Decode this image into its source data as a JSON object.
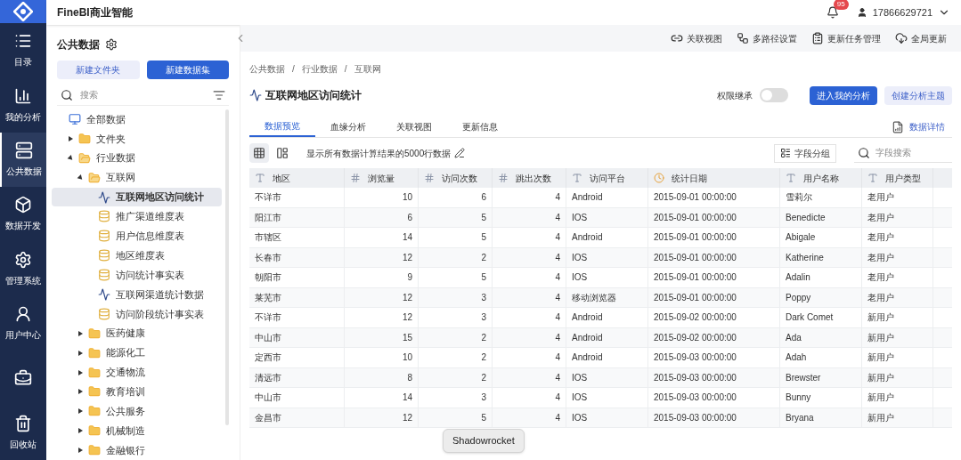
{
  "app": {
    "title": "FineBI商业智能",
    "notifications": "95",
    "user": "17866629721"
  },
  "nav": [
    {
      "label": "目录",
      "selected": false
    },
    {
      "label": "我的分析",
      "selected": false
    },
    {
      "label": "公共数据",
      "selected": true
    },
    {
      "label": "数据开发",
      "selected": false
    },
    {
      "label": "管理系统",
      "selected": false
    },
    {
      "label": "用户中心",
      "selected": false
    },
    {
      "selected": false
    },
    {
      "label": "回收站",
      "selected": false
    }
  ],
  "sidebar": {
    "title": "公共数据",
    "buttons": [
      {
        "label": "新建文件夹",
        "kind": "secondary"
      },
      {
        "label": "新建数据集",
        "kind": "primary"
      }
    ],
    "search": {
      "placeholder": "搜索"
    },
    "tree": [
      {
        "label": "全部数据",
        "kind": "root",
        "selected": false,
        "children": [
          {
            "label": "文件夹",
            "kind": "folder",
            "expanded": false,
            "selected": false
          },
          {
            "label": "行业数据",
            "kind": "folder",
            "expanded": true,
            "selected": false,
            "children": [
              {
                "label": "互联网",
                "kind": "folder",
                "expanded": true,
                "selected": false,
                "children": [
                  {
                    "label": "互联网地区访问统计",
                    "kind": "analysis",
                    "selected": true
                  },
                  {
                    "label": "推广渠道维度表",
                    "kind": "sql",
                    "selected": false
                  },
                  {
                    "label": "用户信息维度表",
                    "kind": "sql",
                    "selected": false
                  },
                  {
                    "label": "地区维度表",
                    "kind": "sql",
                    "selected": false
                  },
                  {
                    "label": "访问统计事实表",
                    "kind": "sql",
                    "selected": false
                  },
                  {
                    "label": "互联网渠道统计数据",
                    "kind": "analysis",
                    "selected": false
                  },
                  {
                    "label": "访问阶段统计事实表",
                    "kind": "sql",
                    "selected": false
                  }
                ]
              },
              {
                "label": "医药健康",
                "kind": "folder",
                "expanded": false,
                "selected": false
              },
              {
                "label": "能源化工",
                "kind": "folder",
                "expanded": false,
                "selected": false
              },
              {
                "label": "交通物流",
                "kind": "folder",
                "expanded": false,
                "selected": false
              },
              {
                "label": "教育培训",
                "kind": "folder",
                "expanded": false,
                "selected": false
              },
              {
                "label": "公共服务",
                "kind": "folder",
                "expanded": false,
                "selected": false
              },
              {
                "label": "机械制造",
                "kind": "folder",
                "expanded": false,
                "selected": false
              },
              {
                "label": "金融银行",
                "kind": "folder",
                "expanded": false,
                "selected": false
              }
            ]
          }
        ]
      }
    ]
  },
  "toolbar": [
    "关联视图",
    "多路径设置",
    "更新任务管理",
    "全局更新"
  ],
  "breadcrumb": [
    "公共数据",
    "/",
    "行业数据",
    "/",
    "互联网"
  ],
  "dataset": {
    "title": "互联网地区访问统计",
    "permission_label": "权限继承",
    "permission_on": false,
    "buttons": [
      {
        "label": "进入我的分析",
        "kind": "primary"
      },
      {
        "label": "创建分析主题",
        "kind": "secondary"
      }
    ]
  },
  "tabs": [
    {
      "label": "数据预览",
      "selected": true
    },
    {
      "label": "血缘分析",
      "selected": false
    },
    {
      "label": "关联视图",
      "selected": false
    },
    {
      "label": "更新信息",
      "selected": false
    }
  ],
  "details_link": "数据详情",
  "preview": {
    "views": [
      {
        "selected": true
      },
      {
        "selected": false
      }
    ],
    "note": "显示所有数据计算结果的5000行数据",
    "group_button": "字段分组",
    "field_search": {
      "placeholder": "字段搜索"
    }
  },
  "table": {
    "columns": [
      {
        "label": "地区",
        "kind": "text"
      },
      {
        "label": "浏览量",
        "kind": "number"
      },
      {
        "label": "访问次数",
        "kind": "number"
      },
      {
        "label": "跳出次数",
        "kind": "number"
      },
      {
        "label": "访问平台",
        "kind": "text"
      },
      {
        "label": "统计日期",
        "kind": "date"
      },
      {
        "label": "用户名称",
        "kind": "text"
      },
      {
        "label": "用户类型",
        "kind": "text"
      }
    ],
    "rows": [
      [
        "不详市",
        "10",
        "6",
        "4",
        "Android",
        "2015-09-01 00:00:00",
        "雪莉尔",
        "老用户"
      ],
      [
        "阳江市",
        "6",
        "5",
        "4",
        "IOS",
        "2015-09-01 00:00:00",
        "Benedicte",
        "老用户"
      ],
      [
        "市辖区",
        "14",
        "5",
        "4",
        "Android",
        "2015-09-01 00:00:00",
        "Abigale",
        "老用户"
      ],
      [
        "长春市",
        "12",
        "2",
        "4",
        "IOS",
        "2015-09-01 00:00:00",
        "Katherine",
        "老用户"
      ],
      [
        "朝阳市",
        "9",
        "5",
        "4",
        "IOS",
        "2015-09-01 00:00:00",
        "Adalin",
        "老用户"
      ],
      [
        "莱芜市",
        "12",
        "3",
        "4",
        "移动浏览器",
        "2015-09-01 00:00:00",
        "Poppy",
        "老用户"
      ],
      [
        "不详市",
        "12",
        "3",
        "4",
        "Android",
        "2015-09-02 00:00:00",
        "Dark Comet",
        "新用户"
      ],
      [
        "中山市",
        "15",
        "2",
        "4",
        "Android",
        "2015-09-02 00:00:00",
        "Ada",
        "新用户"
      ],
      [
        "定西市",
        "10",
        "2",
        "4",
        "Android",
        "2015-09-03 00:00:00",
        "Adah",
        "新用户"
      ],
      [
        "清远市",
        "8",
        "2",
        "4",
        "IOS",
        "2015-09-03 00:00:00",
        "Brewster",
        "新用户"
      ],
      [
        "中山市",
        "14",
        "3",
        "4",
        "IOS",
        "2015-09-03 00:00:00",
        "Bunny",
        "新用户"
      ],
      [
        "金昌市",
        "12",
        "5",
        "4",
        "IOS",
        "2015-09-03 00:00:00",
        "Bryana",
        "新用户"
      ]
    ]
  },
  "tooltip": "Shadowrocket"
}
